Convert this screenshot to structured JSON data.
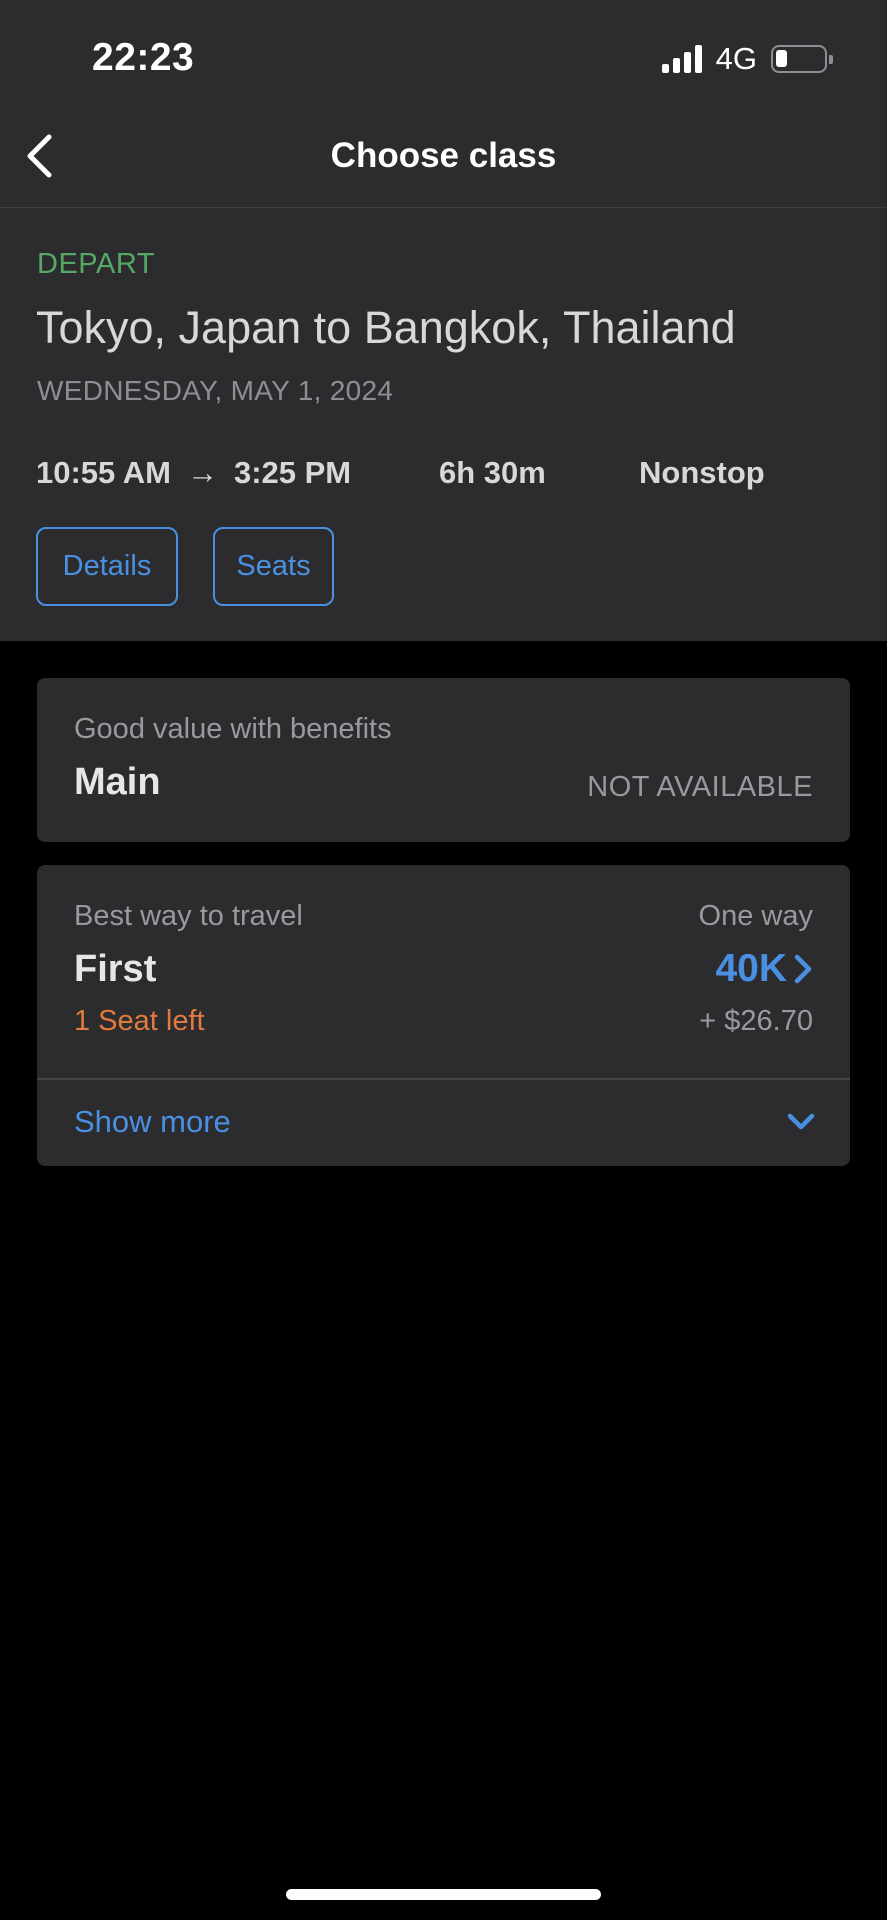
{
  "status_bar": {
    "time": "22:23",
    "network": "4G",
    "signal_icon": "cellular-signal-icon",
    "battery_icon": "battery-icon",
    "battery_level": 0.25
  },
  "nav": {
    "title": "Choose class",
    "back_icon": "chevron-left-icon"
  },
  "flight": {
    "direction": "DEPART",
    "route": "Tokyo, Japan to Bangkok, Thailand",
    "date": "WEDNESDAY, MAY 1, 2024",
    "depart_time": "10:55 AM",
    "arrow": "→",
    "arrive_time": "3:25 PM",
    "duration": "6h 30m",
    "stops": "Nonstop",
    "details_label": "Details",
    "seats_label": "Seats"
  },
  "fares": [
    {
      "subtitle": "Good value with benefits",
      "name": "Main",
      "status": "NOT AVAILABLE"
    },
    {
      "subtitle": "Best way to travel",
      "name": "First",
      "trip_type": "One way",
      "miles": "40K",
      "seats_left": "1 Seat left",
      "fees": "+ $26.70",
      "show_more_label": "Show more"
    }
  ],
  "colors": {
    "background": "#000000",
    "surface": "#2c2c2e",
    "accent_blue": "#4a90e2",
    "depart_green": "#55a866",
    "warning_orange": "#e07a3f",
    "secondary_text": "#9a9a9e"
  }
}
